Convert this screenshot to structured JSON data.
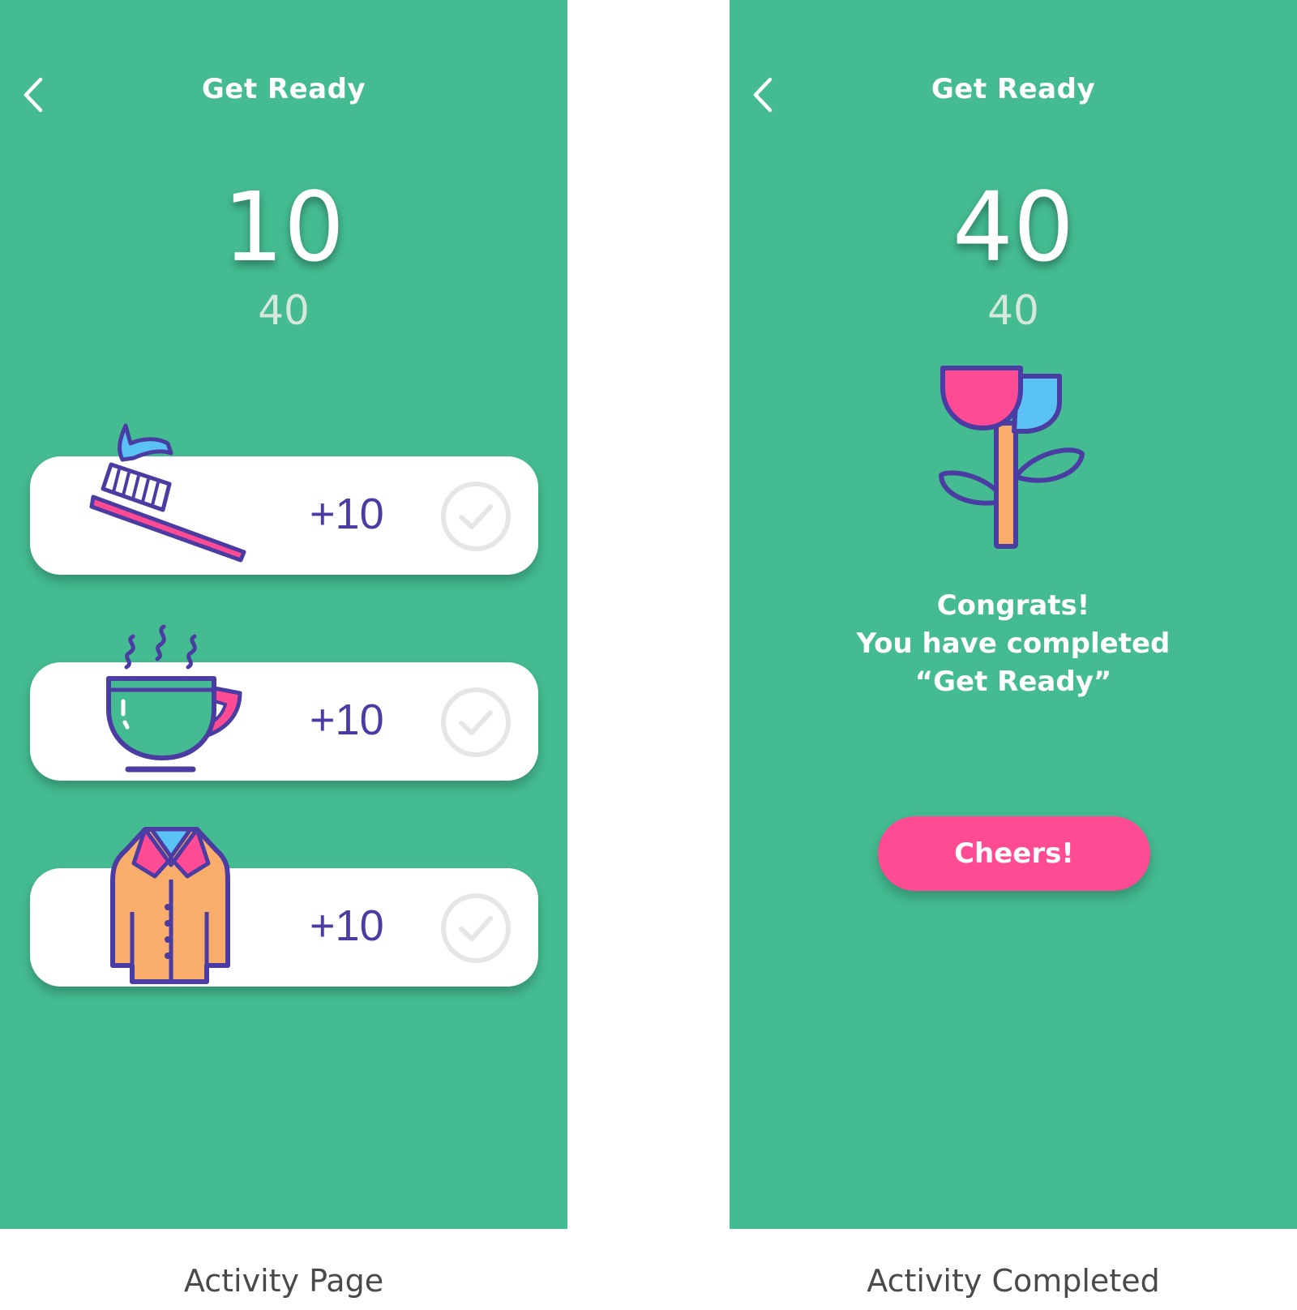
{
  "activity_page": {
    "title": "Get Ready",
    "score": "10",
    "goal": "40",
    "tasks": [
      {
        "icon": "toothbrush-icon",
        "points": "+10",
        "done": false
      },
      {
        "icon": "coffee-cup-icon",
        "points": "+10",
        "done": false
      },
      {
        "icon": "coat-icon",
        "points": "+10",
        "done": false
      }
    ],
    "caption": "Activity Page"
  },
  "activity_completed": {
    "title": "Get Ready",
    "score": "40",
    "goal": "40",
    "icon": "flower-icon",
    "message_line1": "Congrats!",
    "message_line2": "You have completed",
    "message_line3": "“Get Ready”",
    "button_label": "Cheers!",
    "caption": "Activity Completed"
  },
  "colors": {
    "background": "#44bb90",
    "accent_pink": "#ff4a94",
    "icon_purple": "#4b3ca3",
    "icon_blue": "#5bc2f5",
    "icon_orange": "#f8ad6b",
    "card": "#ffffff"
  }
}
